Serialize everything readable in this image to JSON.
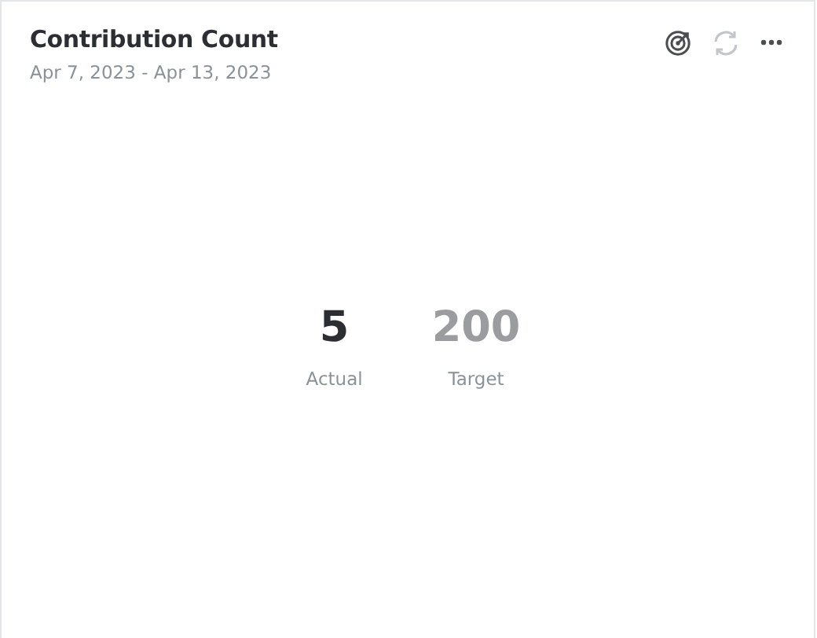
{
  "card": {
    "title": "Contribution Count",
    "date_range": "Apr 7, 2023 - Apr 13, 2023"
  },
  "toolbar": [
    {
      "kind": "target",
      "disabled": false
    },
    {
      "kind": "refresh",
      "disabled": true
    },
    {
      "kind": "more",
      "disabled": false
    }
  ],
  "metrics": [
    {
      "kind": "actual",
      "value": "5",
      "label": "Actual"
    },
    {
      "kind": "target",
      "value": "200",
      "label": "Target"
    }
  ]
}
